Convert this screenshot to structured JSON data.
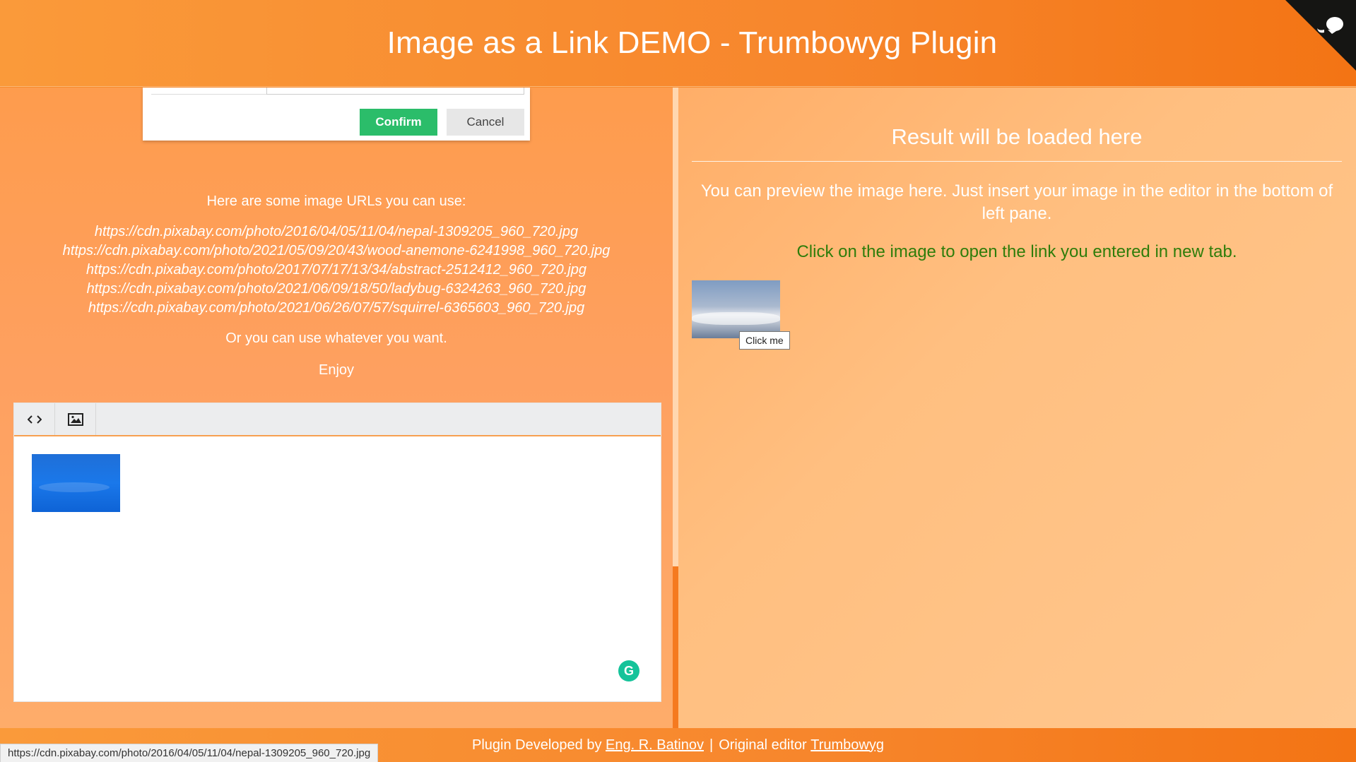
{
  "header": {
    "title": "Image as a Link DEMO - Trumbowyg Plugin"
  },
  "github_corner": {
    "icon": "octocat-icon"
  },
  "modal": {
    "confirm_label": "Confirm",
    "cancel_label": "Cancel"
  },
  "info": {
    "intro": "Here are some image URLs you can use:",
    "urls": [
      "https://cdn.pixabay.com/photo/2016/04/05/11/04/nepal-1309205_960_720.jpg",
      "https://cdn.pixabay.com/photo/2021/05/09/20/43/wood-anemone-6241998_960_720.jpg",
      "https://cdn.pixabay.com/photo/2017/07/17/13/34/abstract-2512412_960_720.jpg",
      "https://cdn.pixabay.com/photo/2021/06/09/18/50/ladybug-6324263_960_720.jpg",
      "https://cdn.pixabay.com/photo/2021/06/26/07/57/squirrel-6365603_960_720.jpg"
    ],
    "or_text": "Or you can use whatever you want.",
    "enjoy_text": "Enjoy"
  },
  "editor": {
    "toolbar": [
      {
        "name": "view-html-button",
        "icon": "code-icon"
      },
      {
        "name": "insert-image-button",
        "icon": "image-icon"
      }
    ],
    "grammarly_label": "G"
  },
  "result": {
    "title": "Result will be loaded here",
    "preview_text": "You can preview the image here. Just insert your image in the editor in the bottom of left pane.",
    "click_text": "Click on the image to open the link you entered in new tab.",
    "tooltip": "Click me"
  },
  "footer": {
    "prefix": "Plugin Developed by",
    "author": "Eng. R. Batinov",
    "separator": "|",
    "original_label": "Original editor",
    "editor_name": "Trumbowyg"
  },
  "statusbar": {
    "url": "https://cdn.pixabay.com/photo/2016/04/05/11/04/nepal-1309205_960_720.jpg"
  },
  "colors": {
    "accent": "#f7862c",
    "confirm": "#2bbd6a",
    "click_text": "#2e7d0a"
  }
}
